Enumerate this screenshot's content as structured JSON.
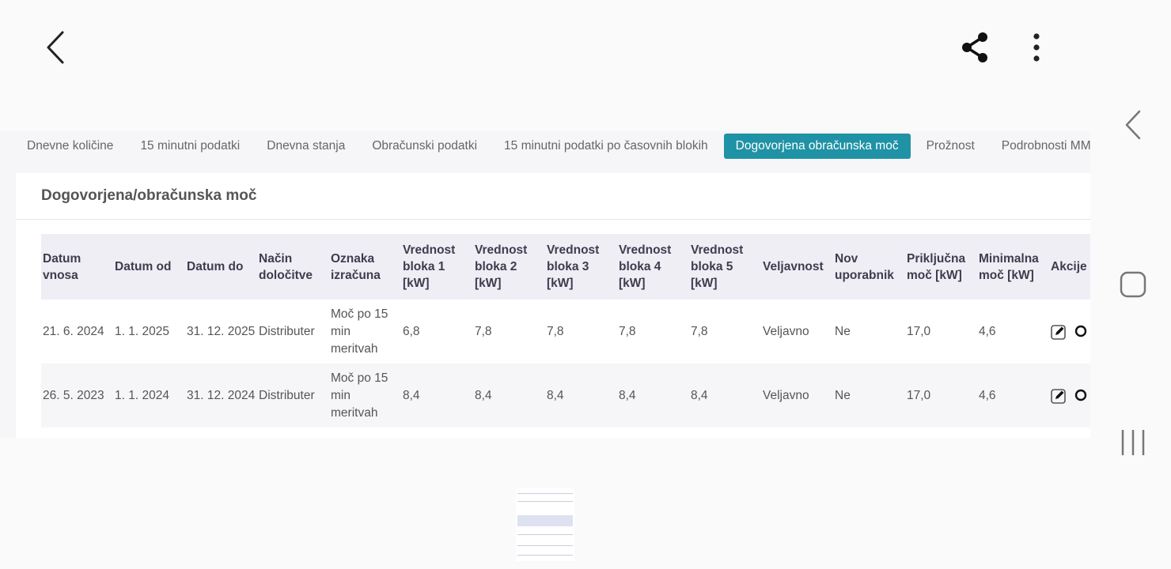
{
  "topbar": {
    "back_icon": "chevron-left-icon",
    "share_icon": "share-icon",
    "more_icon": "more-vertical-icon"
  },
  "tabs": [
    {
      "label": "Dnevne količine",
      "active": false
    },
    {
      "label": "15 minutni podatki",
      "active": false
    },
    {
      "label": "Dnevna stanja",
      "active": false
    },
    {
      "label": "Obračunski podatki",
      "active": false
    },
    {
      "label": "15 minutni podatki po časovnih blokih",
      "active": false
    },
    {
      "label": "Dogovorjena obračunska moč",
      "active": true
    },
    {
      "label": "Prožnost",
      "active": false
    },
    {
      "label": "Podrobnosti MM",
      "active": false
    }
  ],
  "card": {
    "title": "Dogovorjena/obračunska moč"
  },
  "table": {
    "columns": [
      "Datum vnosa",
      "Datum od",
      "Datum do",
      "Način določitve",
      "Oznaka izračuna",
      "Vrednost bloka 1 [kW]",
      "Vrednost bloka 2 [kW]",
      "Vrednost bloka 3 [kW]",
      "Vrednost bloka 4 [kW]",
      "Vrednost bloka 5 [kW]",
      "Veljavnost",
      "Nov uporabnik",
      "Priključna moč [kW]",
      "Minimalna moč [kW]",
      "Akcije"
    ],
    "rows": [
      [
        "21. 6. 2024",
        "1. 1. 2025",
        "31. 12. 2025",
        "Distributer",
        "Moč po 15 min meritvah",
        "6,8",
        "7,8",
        "7,8",
        "7,8",
        "7,8",
        "Veljavno",
        "Ne",
        "17,0",
        "4,6"
      ],
      [
        "26. 5. 2023",
        "1. 1. 2024",
        "31. 12. 2024",
        "Distributer",
        "Moč po 15 min meritvah",
        "8,4",
        "8,4",
        "8,4",
        "8,4",
        "8,4",
        "Veljavno",
        "Ne",
        "17,0",
        "4,6"
      ]
    ],
    "action_icons": [
      "edit-icon",
      "search-icon",
      "chevron-down-icon",
      "chevron-down-icon"
    ]
  },
  "navbar": {
    "back_icon": "chevron-left-icon",
    "home_icon": "home-square-icon",
    "recent_icon": "recent-apps-icon"
  },
  "colors": {
    "accent": "#2092a5",
    "header_bg": "#efeef5"
  }
}
